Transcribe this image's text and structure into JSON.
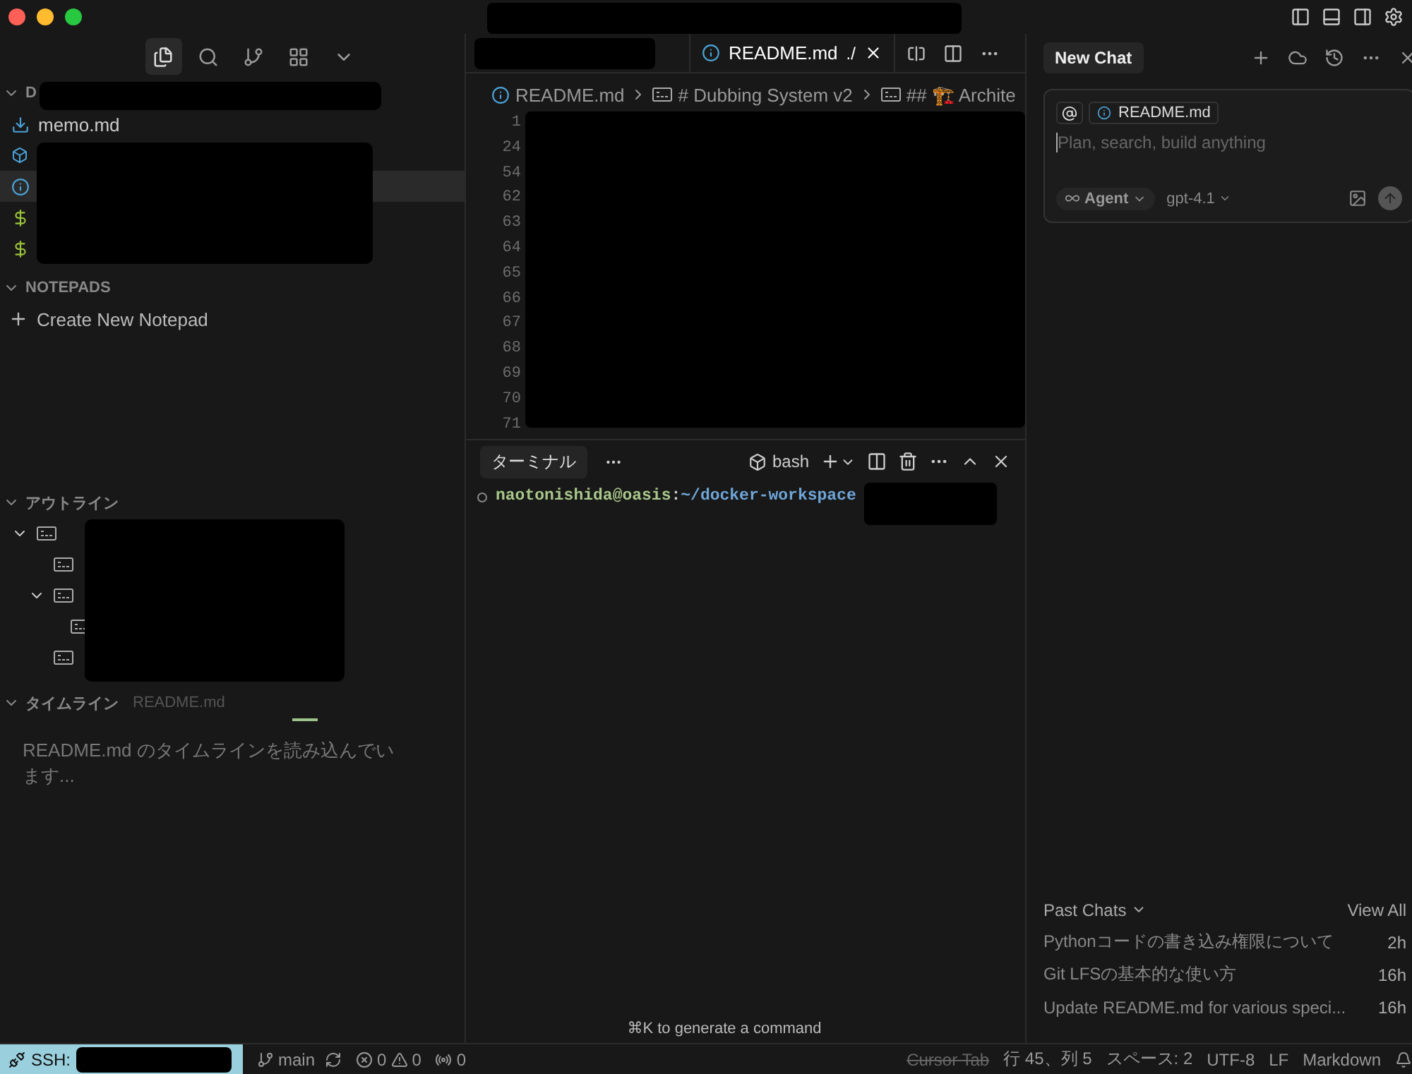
{
  "sidebar": {
    "activity": [
      {
        "selected": true
      },
      {
        "selected": false
      },
      {
        "selected": false
      },
      {
        "selected": false
      },
      {
        "selected": false
      }
    ],
    "explorer": {
      "title": "D",
      "expanded": true,
      "files": [
        {
          "name": "memo.md",
          "kind": "markdown",
          "selected": false
        },
        {
          "kind": "python",
          "selected": false
        },
        {
          "kind": "info",
          "selected": true
        },
        {
          "kind": "shell",
          "selected": false
        },
        {
          "kind": "shell",
          "selected": false
        }
      ]
    },
    "notepads": {
      "title": "NOTEPADS",
      "expanded": true,
      "action": "Create New Notepad"
    },
    "outline": {
      "title": "アウトライン",
      "expanded": true,
      "items": [
        {
          "kind": "heading",
          "expanded": true,
          "children": [
            {
              "kind": "heading"
            },
            {
              "kind": "heading",
              "expanded": true,
              "children": [
                {
                  "kind": "heading"
                }
              ]
            },
            {
              "kind": "heading"
            }
          ]
        }
      ]
    },
    "timeline": {
      "title": "タイムライン",
      "file": "README.md",
      "expanded": true,
      "message": "README.md のタイムラインを読み込んでいます..."
    }
  },
  "editor": {
    "tabs": [
      {
        "label": "README.md",
        "suffix": "./",
        "selected": true
      }
    ],
    "breadcrumbs": [
      {
        "kind": "file",
        "label": "README.md"
      },
      {
        "kind": "heading",
        "label": "# Dubbing System v2"
      },
      {
        "kind": "heading",
        "label": "## 🏗️ Archite"
      }
    ],
    "line_numbers": [
      "1",
      "24",
      "54",
      "62",
      "63",
      "64",
      "65",
      "66",
      "67",
      "68",
      "69",
      "70",
      "71"
    ]
  },
  "terminal": {
    "tab": "ターミナル",
    "shell": "bash",
    "user": "naotonishida@oasis",
    "separator": ":",
    "path": "~/docker-workspace",
    "hint": "⌘K to generate a command"
  },
  "chat": {
    "tab": "New Chat",
    "context": "README.md",
    "placeholder": "Plan, search, build anything",
    "mode": "Agent",
    "model": "gpt-4.1",
    "past_title": "Past Chats",
    "view_all": "View All",
    "past": [
      {
        "title": "Pythonコードの書き込み権限について",
        "age": "2h"
      },
      {
        "title": "Git LFSの基本的な使い方",
        "age": "16h"
      },
      {
        "title": "Update README.md for various speci...",
        "age": "16h"
      }
    ]
  },
  "status_bar": {
    "remote": "SSH:",
    "branch": "main",
    "errors": "0",
    "warnings": "0",
    "ports": "0",
    "cursor_tab": "Cursor Tab",
    "position": "行 45、列 5",
    "spaces": "スペース: 2",
    "encoding": "UTF-8",
    "eol": "LF",
    "language": "Markdown"
  }
}
